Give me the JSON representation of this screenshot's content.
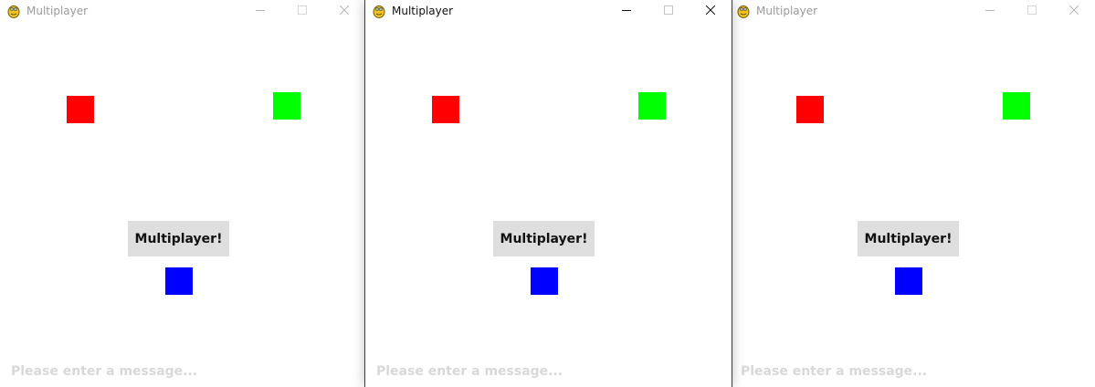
{
  "windows": [
    {
      "id": "left",
      "title": "Multiplayer",
      "active": false,
      "button_label": "Multiplayer!",
      "message_placeholder": "Please enter a message..."
    },
    {
      "id": "center",
      "title": "Multiplayer",
      "active": true,
      "button_label": "Multiplayer!",
      "message_placeholder": "Please enter a message..."
    },
    {
      "id": "right",
      "title": "Multiplayer",
      "active": false,
      "button_label": "Multiplayer!",
      "message_placeholder": "Please enter a message..."
    }
  ],
  "players": [
    {
      "name": "red-square",
      "color": "#ff0000"
    },
    {
      "name": "green-square",
      "color": "#00ff00"
    },
    {
      "name": "blue-square",
      "color": "#0000ff"
    }
  ],
  "icons": {
    "app": "pygame-snake-icon",
    "minimize": "minimize-icon",
    "maximize": "maximize-icon",
    "close": "close-icon"
  },
  "colors": {
    "button_bg": "#dedede",
    "placeholder": "#d8d8d8",
    "inactive_title": "#9a9a9a",
    "active_title": "#111111"
  }
}
